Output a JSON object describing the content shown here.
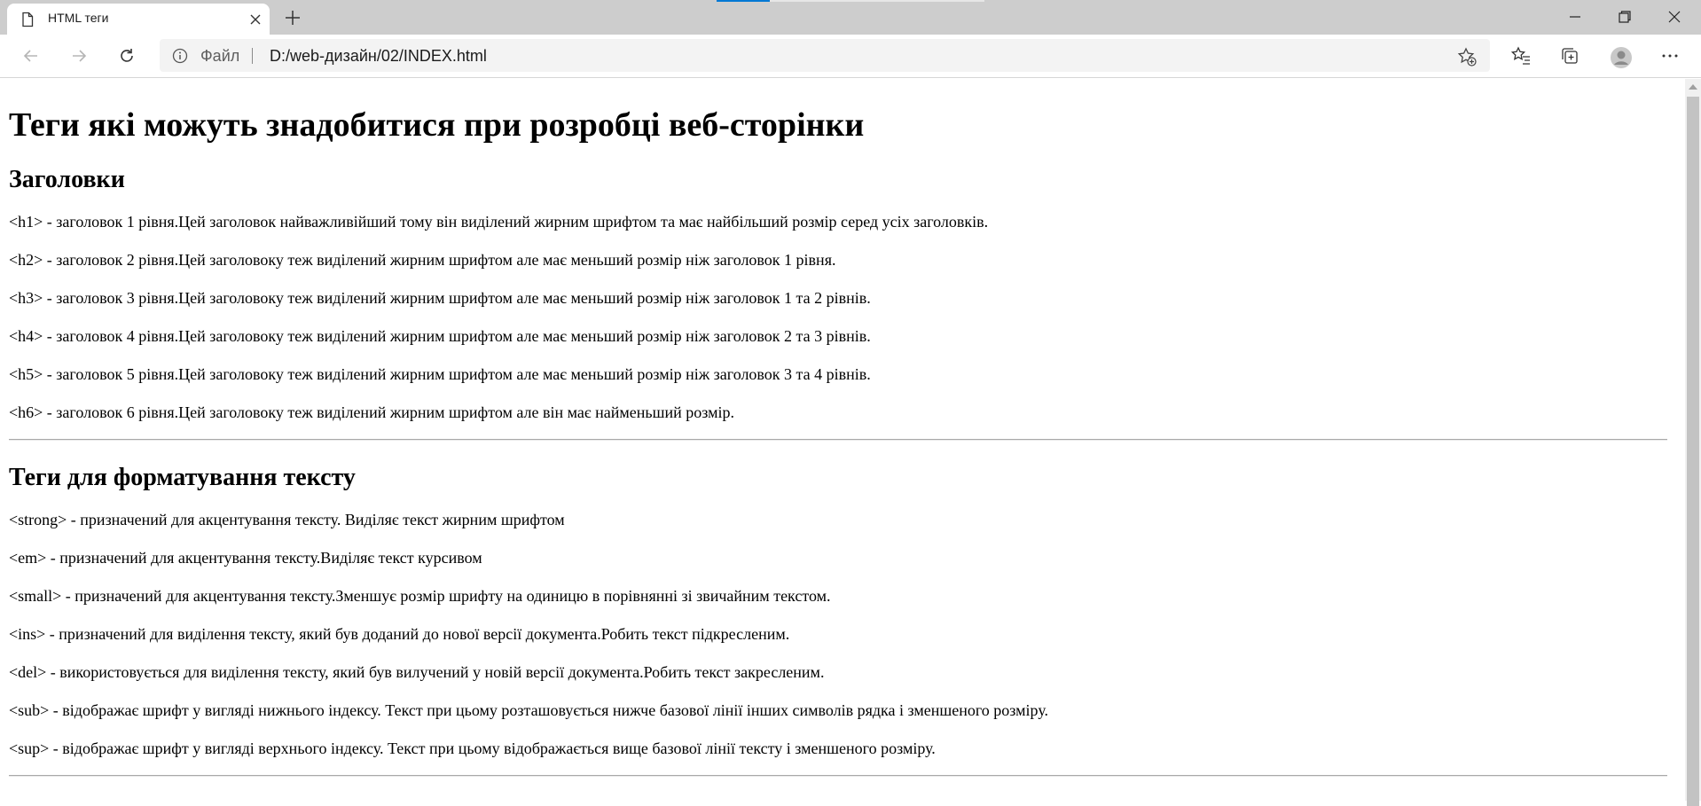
{
  "browser": {
    "tab": {
      "title": "HTML теги"
    },
    "address": {
      "scheme_label": "Файл",
      "url": "D:/web-дизайн/02/INDEX.html"
    }
  },
  "page": {
    "title": "Теги які можуть знадобитися при розробці веб-сторінки",
    "sections": [
      {
        "heading": "Заголовки",
        "items": [
          "<h1> - заголовок 1 рівня.Цей заголовок найважливійший тому він виділений жирним шрифтом та має найбільший розмір серед усіх заголовків.",
          "<h2> - заголовок 2 рівня.Цей заголовоку теж виділений жирним шрифтом але має меньший розмір ніж заголовок 1 рівня.",
          "<h3> - заголовок 3 рівня.Цей заголовоку теж виділений жирним шрифтом але має меньший розмір ніж заголовок 1 та 2 рівнів.",
          "<h4> - заголовок 4 рівня.Цей заголовоку теж виділений жирним шрифтом але має меньший розмір ніж заголовок 2 та 3 рівнів.",
          "<h5> - заголовок 5 рівня.Цей заголовоку теж виділений жирним шрифтом але має меньший розмір ніж заголовок 3 та 4 рівнів.",
          "<h6> - заголовок 6 рівня.Цей заголовоку теж виділений жирним шрифтом але він має найменьший розмір."
        ]
      },
      {
        "heading": "Теги для форматування тексту",
        "items": [
          "<strong> - призначений для акцентування тексту. Виділяє текст жирним шрифтом",
          "<em> - призначений для акцентування тексту.Виділяє текст курсивом",
          "<small> - призначений для акцентування тексту.Зменшує розмір шрифту на одиницю в порівнянні зі звичайним текстом.",
          "<ins> - призначений для виділення тексту, який був доданий до нової версії документа.Робить текст підкресленим.",
          "<del> - використовується для виділення тексту, який був вилучений у новій версії документа.Робить текст закресленим.",
          "<sub> - відображає шрифт у вигляді нижнього індексу. Текст при цьому розташовується нижче базової лінії інших символів рядка і зменшеного розміру.",
          "<sup> - відображає шрифт у вигляді верхнього індексу. Текст при цьому відображається вище базової лінії тексту і зменшеного розміру."
        ]
      }
    ]
  },
  "colors": {
    "accent": "#0078d4",
    "tabstrip": "#cdcdcd",
    "toolbar": "#ffffff",
    "address_bg": "#f3f3f3"
  },
  "icons": [
    "page-icon",
    "close-icon",
    "plus-icon",
    "minimize-icon",
    "restore-icon",
    "close-window-icon",
    "back-icon",
    "forward-icon",
    "refresh-icon",
    "info-icon",
    "add-favorite-icon",
    "favorites-icon",
    "collections-icon",
    "profile-icon",
    "more-icon"
  ]
}
